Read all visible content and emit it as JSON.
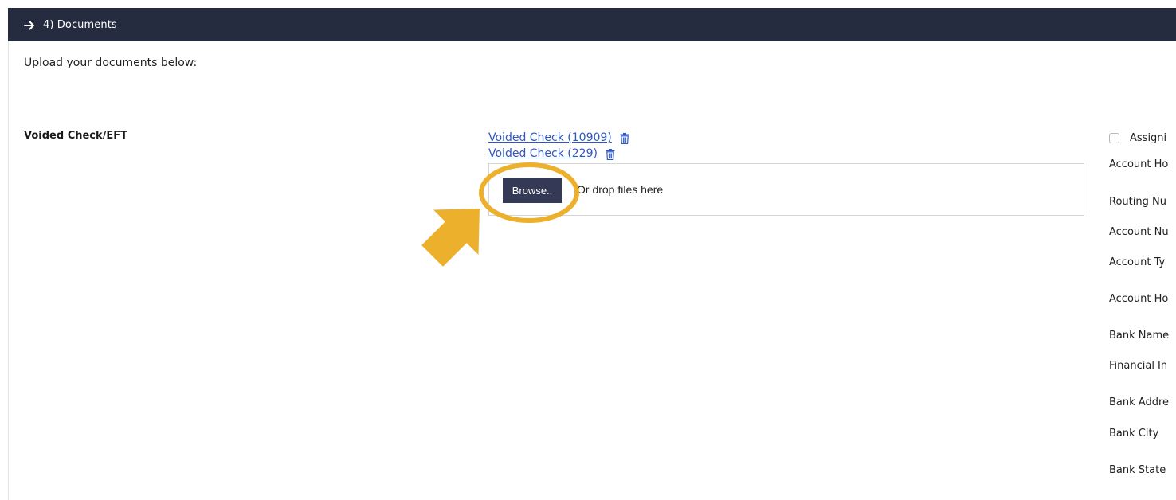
{
  "section": {
    "title": "4) Documents",
    "arrow_icon": "arrow-right-icon"
  },
  "intro_text": "Upload your documents below:",
  "document": {
    "label": "Voided Check/EFT",
    "files": [
      {
        "name": "Voided Check (10909)",
        "delete_icon": "trash-icon"
      },
      {
        "name": "Voided Check (229)",
        "delete_icon": "trash-icon"
      }
    ],
    "browse_label": "Browse..",
    "drop_text": "Or drop files here"
  },
  "bank_panel": {
    "assign_label": "Assigni",
    "assign_checked": false,
    "fields": [
      "Account Ho",
      "Routing Nu",
      "Account Nu",
      "Account Ty",
      "Account Ho",
      "Bank Name",
      "Financial In",
      "Bank Addre",
      "Bank City",
      "Bank State"
    ]
  },
  "colors": {
    "header_bg": "#262c3f",
    "button_bg": "#343a55",
    "link": "#2e56c4",
    "highlight": "#edb02d"
  }
}
